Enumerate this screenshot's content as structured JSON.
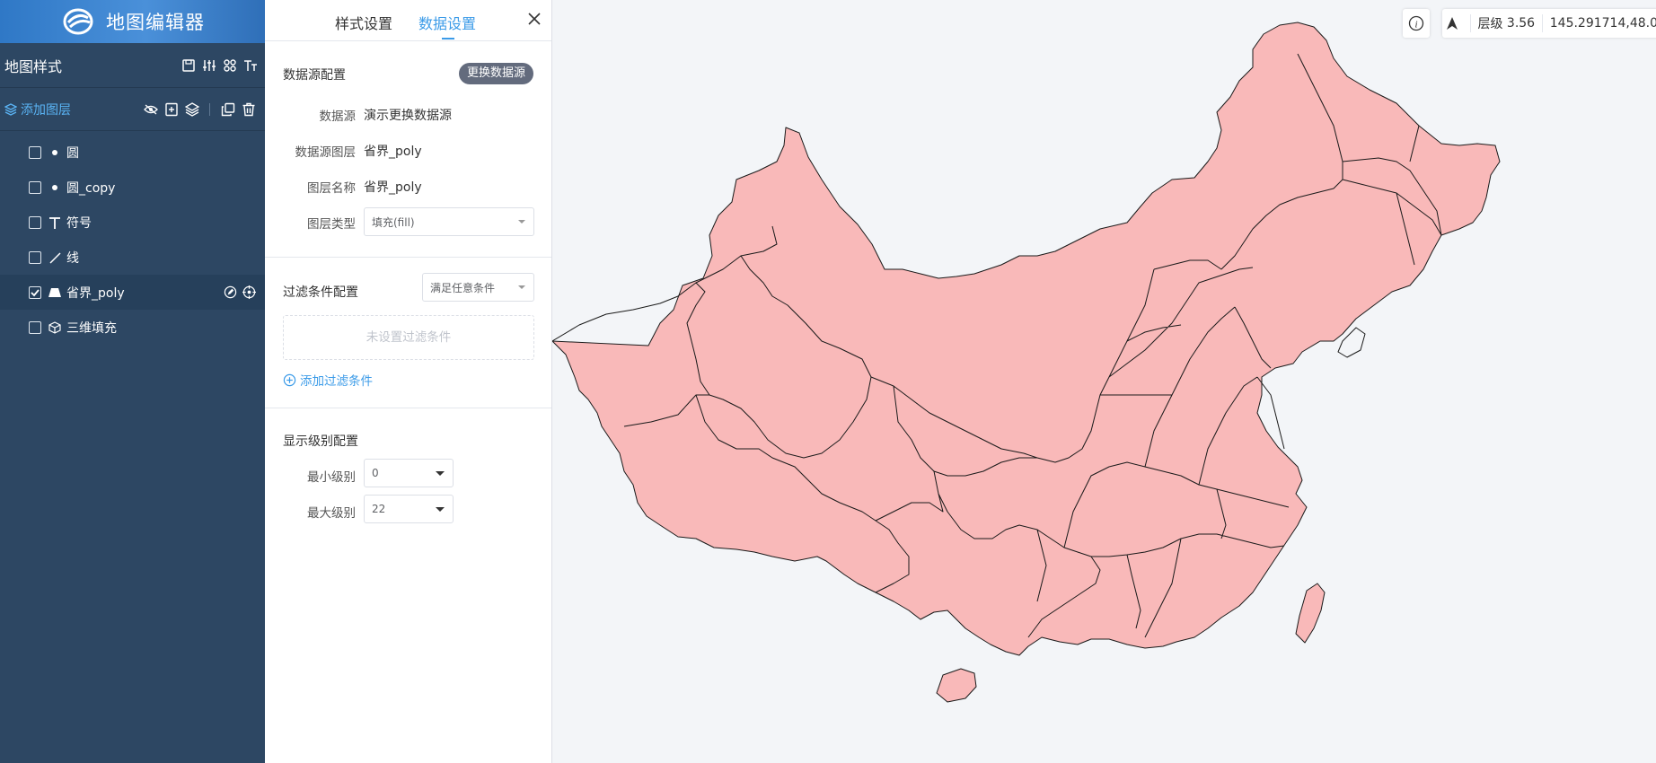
{
  "app": {
    "title": "地图编辑器"
  },
  "sidebar": {
    "style_title": "地图样式",
    "add_layer": "添加图层",
    "layers": [
      {
        "label": "圆",
        "type_icon": "circle-icon",
        "checked": false
      },
      {
        "label": "圆_copy",
        "type_icon": "circle-icon",
        "checked": false
      },
      {
        "label": "符号",
        "type_icon": "text-symbol-icon",
        "checked": false
      },
      {
        "label": "线",
        "type_icon": "line-icon",
        "checked": false
      },
      {
        "label": "省界_poly",
        "type_icon": "polygon-icon",
        "checked": true,
        "active": true
      },
      {
        "label": "三维填充",
        "type_icon": "cube-icon",
        "checked": false
      }
    ]
  },
  "panel": {
    "tabs": [
      "样式设置",
      "数据设置"
    ],
    "active_tab": "数据设置",
    "datasource": {
      "title": "数据源配置",
      "change_button": "更换数据源",
      "fields": [
        {
          "label": "数据源",
          "value": "演示更换数据源"
        },
        {
          "label": "数据源图层",
          "value": "省界_poly"
        },
        {
          "label": "图层名称",
          "value": "省界_poly"
        }
      ],
      "type_label": "图层类型",
      "type_value": "填充(fill)"
    },
    "filter": {
      "title": "过滤条件配置",
      "mode": "满足任意条件",
      "empty_text": "未设置过滤条件",
      "add_label": "添加过滤条件"
    },
    "zoom": {
      "title": "显示级别配置",
      "min_label": "最小级别",
      "min_value": "0",
      "max_label": "最大级别",
      "max_value": "22"
    }
  },
  "map": {
    "zoom_label": "层级",
    "zoom_value": "3.56",
    "coordinates": "145.291714,48.0",
    "fill_color": "#f9b9b9",
    "stroke_color": "#1a1a1a"
  },
  "colors": {
    "sidebar_bg": "#2d4763",
    "accent": "#3b9be8"
  }
}
